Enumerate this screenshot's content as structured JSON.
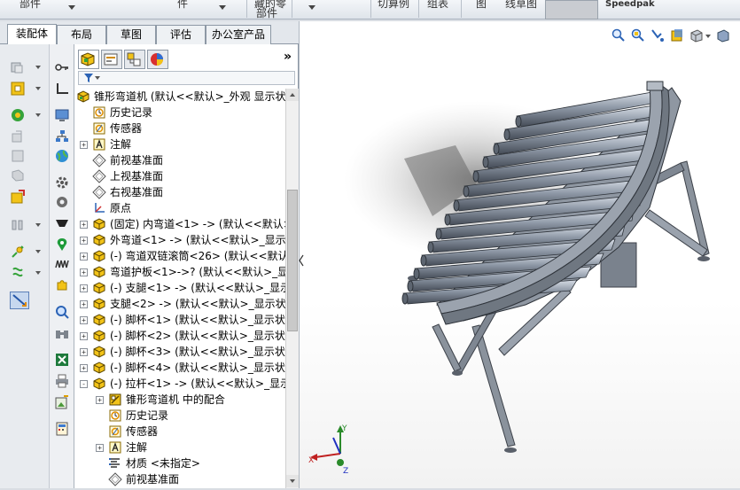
{
  "ribbon": {
    "items": [
      {
        "label": "部件"
      },
      {
        "label": "件"
      },
      {
        "label": "藏的零"
      },
      {
        "label": "部件"
      },
      {
        "label": "切算例"
      },
      {
        "label": "组表"
      },
      {
        "label": "图"
      },
      {
        "label": "线草图"
      },
      {
        "label": "Speedpak"
      }
    ]
  },
  "tabs": [
    {
      "label": "装配体"
    },
    {
      "label": "布局"
    },
    {
      "label": "草图"
    },
    {
      "label": "评估"
    },
    {
      "label": "办公室产品"
    }
  ],
  "feature_manager": {
    "more_label": "»",
    "tree": [
      {
        "label": "锥形弯道机 (默认<<默认>_外观 显示状",
        "icon": "assembly-icon",
        "expander": "",
        "level": 0
      },
      {
        "label": "历史记录",
        "icon": "history-icon",
        "expander": "",
        "level": 1
      },
      {
        "label": "传感器",
        "icon": "sensor-icon",
        "expander": "",
        "level": 1
      },
      {
        "label": "注解",
        "icon": "annotation-icon",
        "expander": "+",
        "level": 1
      },
      {
        "label": "前视基准面",
        "icon": "plane-icon",
        "expander": "",
        "level": 1
      },
      {
        "label": "上视基准面",
        "icon": "plane-icon",
        "expander": "",
        "level": 1
      },
      {
        "label": "右视基准面",
        "icon": "plane-icon",
        "expander": "",
        "level": 1
      },
      {
        "label": "原点",
        "icon": "origin-icon",
        "expander": "",
        "level": 1
      },
      {
        "label": "(固定) 内弯道<1> -> (默认<<默认>",
        "icon": "part-icon",
        "expander": "+",
        "level": 1
      },
      {
        "label": "外弯道<1> -> (默认<<默认>_显示",
        "icon": "part-icon",
        "expander": "+",
        "level": 1
      },
      {
        "label": "(-) 弯道双链滚筒<26> (默认<<默认",
        "icon": "part-icon",
        "expander": "+",
        "level": 1
      },
      {
        "label": "弯道护板<1>->? (默认<<默认>_显",
        "icon": "part-icon",
        "expander": "+",
        "level": 1
      },
      {
        "label": "(-) 支腿<1> -> (默认<<默认>_显示",
        "icon": "part-icon",
        "expander": "+",
        "level": 1
      },
      {
        "label": "支腿<2> -> (默认<<默认>_显示状态",
        "icon": "part-icon",
        "expander": "+",
        "level": 1
      },
      {
        "label": "(-) 脚杯<1> (默认<<默认>_显示状态",
        "icon": "part-icon",
        "expander": "+",
        "level": 1
      },
      {
        "label": "(-) 脚杯<2> (默认<<默认>_显示状态",
        "icon": "part-icon",
        "expander": "+",
        "level": 1
      },
      {
        "label": "(-) 脚杯<3> (默认<<默认>_显示状态",
        "icon": "part-icon",
        "expander": "+",
        "level": 1
      },
      {
        "label": "(-) 脚杯<4> (默认<<默认>_显示状态",
        "icon": "part-icon",
        "expander": "+",
        "level": 1
      },
      {
        "label": "(-) 拉杆<1> -> (默认<<默认>_显示",
        "icon": "part-icon",
        "expander": "-",
        "level": 1
      },
      {
        "label": "锥形弯道机 中的配合",
        "icon": "mates-icon",
        "expander": "+",
        "level": 2
      },
      {
        "label": "历史记录",
        "icon": "history-icon",
        "expander": "",
        "level": 2
      },
      {
        "label": "传感器",
        "icon": "sensor-icon",
        "expander": "",
        "level": 2
      },
      {
        "label": "注解",
        "icon": "annotation-icon",
        "expander": "+",
        "level": 2
      },
      {
        "label": "材质 <未指定>",
        "icon": "material-icon",
        "expander": "",
        "level": 2
      },
      {
        "label": "前视基准面",
        "icon": "plane-icon",
        "expander": "",
        "level": 2
      }
    ]
  },
  "viewport": {
    "triad": {
      "x_label": "X",
      "y_label": "Y",
      "z_label": "Z"
    }
  },
  "colors": {
    "part_yellow": "#e8c21a",
    "selection_blue": "#3a6fd8",
    "frame_gray": "#7c8592"
  }
}
